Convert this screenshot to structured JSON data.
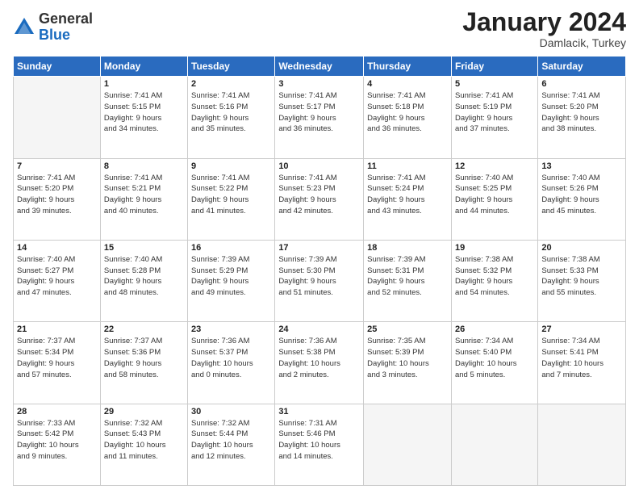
{
  "logo": {
    "general": "General",
    "blue": "Blue"
  },
  "header": {
    "month": "January 2024",
    "location": "Damlacik, Turkey"
  },
  "weekdays": [
    "Sunday",
    "Monday",
    "Tuesday",
    "Wednesday",
    "Thursday",
    "Friday",
    "Saturday"
  ],
  "weeks": [
    [
      {
        "day": "",
        "info": ""
      },
      {
        "day": "1",
        "info": "Sunrise: 7:41 AM\nSunset: 5:15 PM\nDaylight: 9 hours\nand 34 minutes."
      },
      {
        "day": "2",
        "info": "Sunrise: 7:41 AM\nSunset: 5:16 PM\nDaylight: 9 hours\nand 35 minutes."
      },
      {
        "day": "3",
        "info": "Sunrise: 7:41 AM\nSunset: 5:17 PM\nDaylight: 9 hours\nand 36 minutes."
      },
      {
        "day": "4",
        "info": "Sunrise: 7:41 AM\nSunset: 5:18 PM\nDaylight: 9 hours\nand 36 minutes."
      },
      {
        "day": "5",
        "info": "Sunrise: 7:41 AM\nSunset: 5:19 PM\nDaylight: 9 hours\nand 37 minutes."
      },
      {
        "day": "6",
        "info": "Sunrise: 7:41 AM\nSunset: 5:20 PM\nDaylight: 9 hours\nand 38 minutes."
      }
    ],
    [
      {
        "day": "7",
        "info": "Sunrise: 7:41 AM\nSunset: 5:20 PM\nDaylight: 9 hours\nand 39 minutes."
      },
      {
        "day": "8",
        "info": "Sunrise: 7:41 AM\nSunset: 5:21 PM\nDaylight: 9 hours\nand 40 minutes."
      },
      {
        "day": "9",
        "info": "Sunrise: 7:41 AM\nSunset: 5:22 PM\nDaylight: 9 hours\nand 41 minutes."
      },
      {
        "day": "10",
        "info": "Sunrise: 7:41 AM\nSunset: 5:23 PM\nDaylight: 9 hours\nand 42 minutes."
      },
      {
        "day": "11",
        "info": "Sunrise: 7:41 AM\nSunset: 5:24 PM\nDaylight: 9 hours\nand 43 minutes."
      },
      {
        "day": "12",
        "info": "Sunrise: 7:40 AM\nSunset: 5:25 PM\nDaylight: 9 hours\nand 44 minutes."
      },
      {
        "day": "13",
        "info": "Sunrise: 7:40 AM\nSunset: 5:26 PM\nDaylight: 9 hours\nand 45 minutes."
      }
    ],
    [
      {
        "day": "14",
        "info": "Sunrise: 7:40 AM\nSunset: 5:27 PM\nDaylight: 9 hours\nand 47 minutes."
      },
      {
        "day": "15",
        "info": "Sunrise: 7:40 AM\nSunset: 5:28 PM\nDaylight: 9 hours\nand 48 minutes."
      },
      {
        "day": "16",
        "info": "Sunrise: 7:39 AM\nSunset: 5:29 PM\nDaylight: 9 hours\nand 49 minutes."
      },
      {
        "day": "17",
        "info": "Sunrise: 7:39 AM\nSunset: 5:30 PM\nDaylight: 9 hours\nand 51 minutes."
      },
      {
        "day": "18",
        "info": "Sunrise: 7:39 AM\nSunset: 5:31 PM\nDaylight: 9 hours\nand 52 minutes."
      },
      {
        "day": "19",
        "info": "Sunrise: 7:38 AM\nSunset: 5:32 PM\nDaylight: 9 hours\nand 54 minutes."
      },
      {
        "day": "20",
        "info": "Sunrise: 7:38 AM\nSunset: 5:33 PM\nDaylight: 9 hours\nand 55 minutes."
      }
    ],
    [
      {
        "day": "21",
        "info": "Sunrise: 7:37 AM\nSunset: 5:34 PM\nDaylight: 9 hours\nand 57 minutes."
      },
      {
        "day": "22",
        "info": "Sunrise: 7:37 AM\nSunset: 5:36 PM\nDaylight: 9 hours\nand 58 minutes."
      },
      {
        "day": "23",
        "info": "Sunrise: 7:36 AM\nSunset: 5:37 PM\nDaylight: 10 hours\nand 0 minutes."
      },
      {
        "day": "24",
        "info": "Sunrise: 7:36 AM\nSunset: 5:38 PM\nDaylight: 10 hours\nand 2 minutes."
      },
      {
        "day": "25",
        "info": "Sunrise: 7:35 AM\nSunset: 5:39 PM\nDaylight: 10 hours\nand 3 minutes."
      },
      {
        "day": "26",
        "info": "Sunrise: 7:34 AM\nSunset: 5:40 PM\nDaylight: 10 hours\nand 5 minutes."
      },
      {
        "day": "27",
        "info": "Sunrise: 7:34 AM\nSunset: 5:41 PM\nDaylight: 10 hours\nand 7 minutes."
      }
    ],
    [
      {
        "day": "28",
        "info": "Sunrise: 7:33 AM\nSunset: 5:42 PM\nDaylight: 10 hours\nand 9 minutes."
      },
      {
        "day": "29",
        "info": "Sunrise: 7:32 AM\nSunset: 5:43 PM\nDaylight: 10 hours\nand 11 minutes."
      },
      {
        "day": "30",
        "info": "Sunrise: 7:32 AM\nSunset: 5:44 PM\nDaylight: 10 hours\nand 12 minutes."
      },
      {
        "day": "31",
        "info": "Sunrise: 7:31 AM\nSunset: 5:46 PM\nDaylight: 10 hours\nand 14 minutes."
      },
      {
        "day": "",
        "info": ""
      },
      {
        "day": "",
        "info": ""
      },
      {
        "day": "",
        "info": ""
      }
    ]
  ]
}
